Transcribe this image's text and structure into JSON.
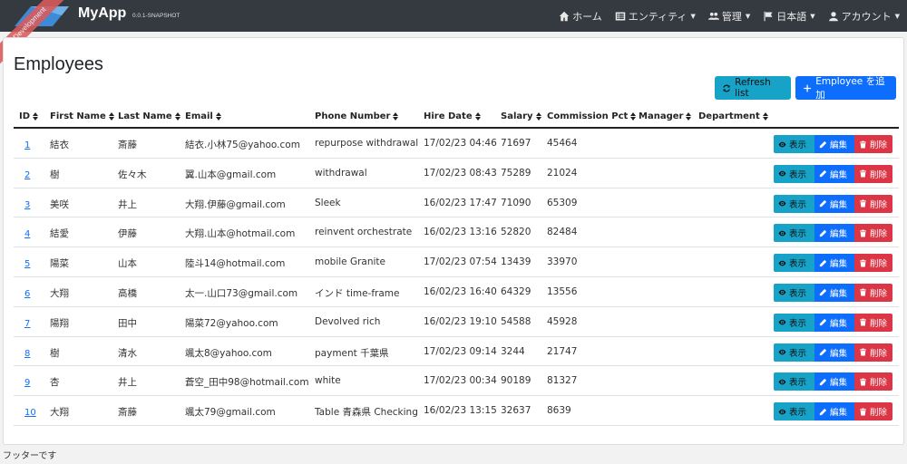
{
  "navbar": {
    "brand": "MyApp",
    "version": "0.0.1-SNAPSHOT",
    "ribbon": "Development",
    "items": [
      {
        "label": "ホーム",
        "icon": "home-icon",
        "caret": false
      },
      {
        "label": "エンティティ",
        "icon": "list-icon",
        "caret": true
      },
      {
        "label": "管理",
        "icon": "users-icon",
        "caret": true
      },
      {
        "label": "日本語",
        "icon": "flag-icon",
        "caret": true
      },
      {
        "label": "アカウント",
        "icon": "user-icon",
        "caret": true
      }
    ]
  },
  "page": {
    "title": "Employees",
    "refresh_label": "Refresh list",
    "add_label": "Employee を追加"
  },
  "table": {
    "headers": [
      "ID",
      "First Name",
      "Last Name",
      "Email",
      "Phone Number",
      "Hire Date",
      "Salary",
      "Commission Pct",
      "Manager",
      "Department"
    ],
    "action_labels": {
      "view": "表示",
      "edit": "編集",
      "delete": "削除"
    },
    "rows": [
      {
        "id": "1",
        "first": "結衣",
        "last": "斎藤",
        "email": "結衣.小林75@yahoo.com",
        "phone": "repurpose withdrawal",
        "hire": "17/02/23 04:46",
        "salary": "71697",
        "commission": "45464"
      },
      {
        "id": "2",
        "first": "樹",
        "last": "佐々木",
        "email": "翼.山本@gmail.com",
        "phone": "withdrawal",
        "hire": "17/02/23 08:43",
        "salary": "75289",
        "commission": "21024"
      },
      {
        "id": "3",
        "first": "美咲",
        "last": "井上",
        "email": "大翔.伊藤@gmail.com",
        "phone": "Sleek",
        "hire": "16/02/23 17:47",
        "salary": "71090",
        "commission": "65309"
      },
      {
        "id": "4",
        "first": "結愛",
        "last": "伊藤",
        "email": "大翔.山本@hotmail.com",
        "phone": "reinvent orchestrate",
        "hire": "16/02/23 13:16",
        "salary": "52820",
        "commission": "82484"
      },
      {
        "id": "5",
        "first": "陽菜",
        "last": "山本",
        "email": "陸斗14@hotmail.com",
        "phone": "mobile Granite",
        "hire": "17/02/23 07:54",
        "salary": "13439",
        "commission": "33970"
      },
      {
        "id": "6",
        "first": "大翔",
        "last": "高橋",
        "email": "太一.山口73@gmail.com",
        "phone": "インド time-frame",
        "hire": "16/02/23 16:40",
        "salary": "64329",
        "commission": "13556"
      },
      {
        "id": "7",
        "first": "陽翔",
        "last": "田中",
        "email": "陽菜72@yahoo.com",
        "phone": "Devolved rich",
        "hire": "16/02/23 19:10",
        "salary": "54588",
        "commission": "45928"
      },
      {
        "id": "8",
        "first": "樹",
        "last": "清水",
        "email": "颯太8@yahoo.com",
        "phone": "payment 千葉県",
        "hire": "17/02/23 09:14",
        "salary": "3244",
        "commission": "21747"
      },
      {
        "id": "9",
        "first": "杏",
        "last": "井上",
        "email": "蒼空_田中98@hotmail.com",
        "phone": "white",
        "hire": "17/02/23 00:34",
        "salary": "90189",
        "commission": "81327"
      },
      {
        "id": "10",
        "first": "大翔",
        "last": "斎藤",
        "email": "颯太79@gmail.com",
        "phone": "Table 青森県 Checking",
        "hire": "16/02/23 13:15",
        "salary": "32637",
        "commission": "8639"
      }
    ]
  },
  "footer": {
    "text": "フッターです"
  },
  "colors": {
    "navbar": "#353a40",
    "info": "#17a2c8",
    "primary": "#0d6efd",
    "danger": "#dc3545",
    "ribbon": "#dc5a5a"
  }
}
